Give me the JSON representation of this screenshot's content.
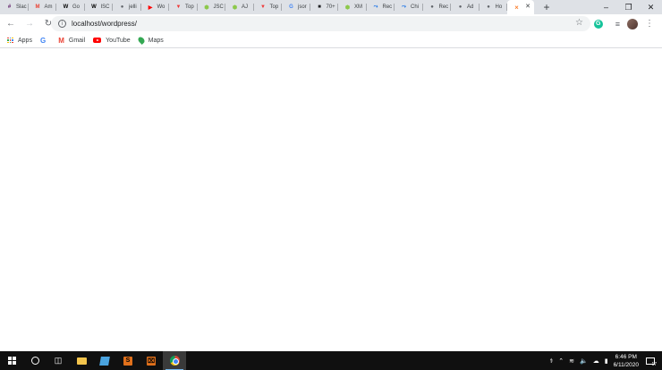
{
  "tabs": [
    {
      "label": "Slac",
      "icon": "slack-icon",
      "color": "#611f69"
    },
    {
      "label": "Am",
      "icon": "gmail-icon",
      "color": "#ea4335"
    },
    {
      "label": "Go",
      "icon": "wikipedia-icon",
      "color": "#000000"
    },
    {
      "label": "ISC",
      "icon": "wikipedia-icon",
      "color": "#000000"
    },
    {
      "label": "jelli",
      "icon": "globe-icon",
      "color": "#5f6368"
    },
    {
      "label": "Wo",
      "icon": "youtube-icon",
      "color": "#ff0000"
    },
    {
      "label": "Top",
      "icon": "vivaldi-icon",
      "color": "#ef3939"
    },
    {
      "label": "JSC",
      "icon": "nodejs-icon",
      "color": "#8cc84b"
    },
    {
      "label": "AJ",
      "icon": "nodejs-icon",
      "color": "#8cc84b"
    },
    {
      "label": "Top",
      "icon": "vivaldi-icon",
      "color": "#ef3939"
    },
    {
      "label": "jsor",
      "icon": "google-icon",
      "color": "#4285f4"
    },
    {
      "label": "70+",
      "icon": "dark-site-icon",
      "color": "#202124"
    },
    {
      "label": "XM",
      "icon": "nodejs-icon",
      "color": "#8cc84b"
    },
    {
      "label": "Rec",
      "icon": "arrow-site-icon",
      "color": "#1a73e8"
    },
    {
      "label": "Chi",
      "icon": "arrow-site-icon",
      "color": "#1a73e8"
    },
    {
      "label": "Rec",
      "icon": "globe-icon",
      "color": "#5f6368"
    },
    {
      "label": "Ad",
      "icon": "globe-icon",
      "color": "#5f6368"
    },
    {
      "label": "Ho",
      "icon": "globe-icon",
      "color": "#5f6368"
    },
    {
      "label": "",
      "icon": "xampp-icon",
      "color": "#fb7a24",
      "active": true
    }
  ],
  "toolbar": {
    "url": "localhost/wordpress/"
  },
  "bookmarks": [
    {
      "label": "Apps",
      "icon": "apps-grid-icon"
    },
    {
      "label": "",
      "icon": "google-icon"
    },
    {
      "label": "Gmail",
      "icon": "gmail-icon"
    },
    {
      "label": "YouTube",
      "icon": "youtube-icon"
    },
    {
      "label": "Maps",
      "icon": "maps-icon"
    }
  ],
  "taskbar": {
    "time": "6:46 PM",
    "date": "6/11/2020",
    "notification_count": "17"
  },
  "colors": {
    "tabstrip_bg": "#dee1e6",
    "taskbar_bg": "#101010",
    "accent": "#76b9ed"
  }
}
